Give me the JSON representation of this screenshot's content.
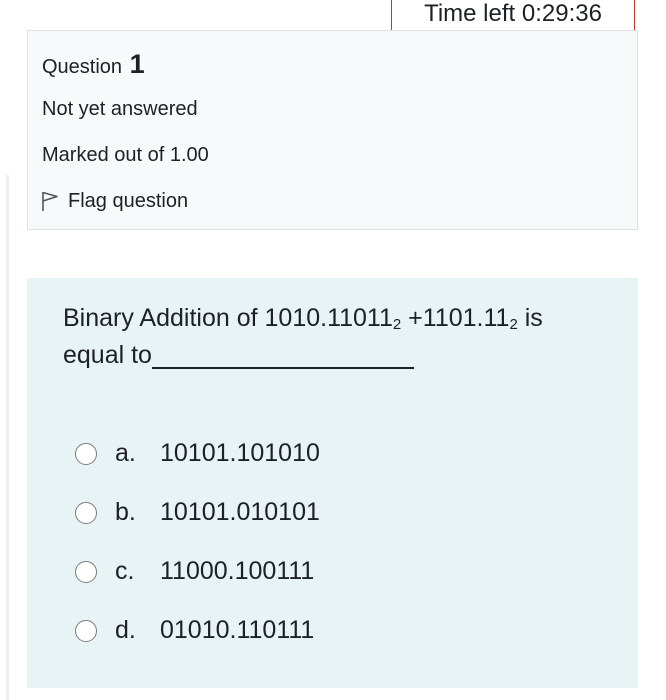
{
  "timer": {
    "label": "Time left",
    "value": "0:29:36"
  },
  "question_info": {
    "heading_label": "Question",
    "number": "1",
    "state": "Not yet answered",
    "grade": "Marked out of 1.00",
    "flag_label": "Flag question",
    "flag_icon": "flag-outline-icon"
  },
  "question": {
    "text_prefix": "Binary Addition of 1010.11011",
    "base_1": "2",
    "text_middle": " +1101.11",
    "base_2": "2",
    "text_suffix": " is equal to",
    "options": [
      {
        "letter": "a.",
        "value": "10101.101010"
      },
      {
        "letter": "b.",
        "value": "10101.010101"
      },
      {
        "letter": "c.",
        "value": "11000.100111"
      },
      {
        "letter": "d.",
        "value": "01010.110111"
      }
    ]
  },
  "colors": {
    "timer_border": "#c0392b",
    "info_background": "#f8f9fa",
    "content_background": "#e7f3f5",
    "text": "#1d2125"
  }
}
